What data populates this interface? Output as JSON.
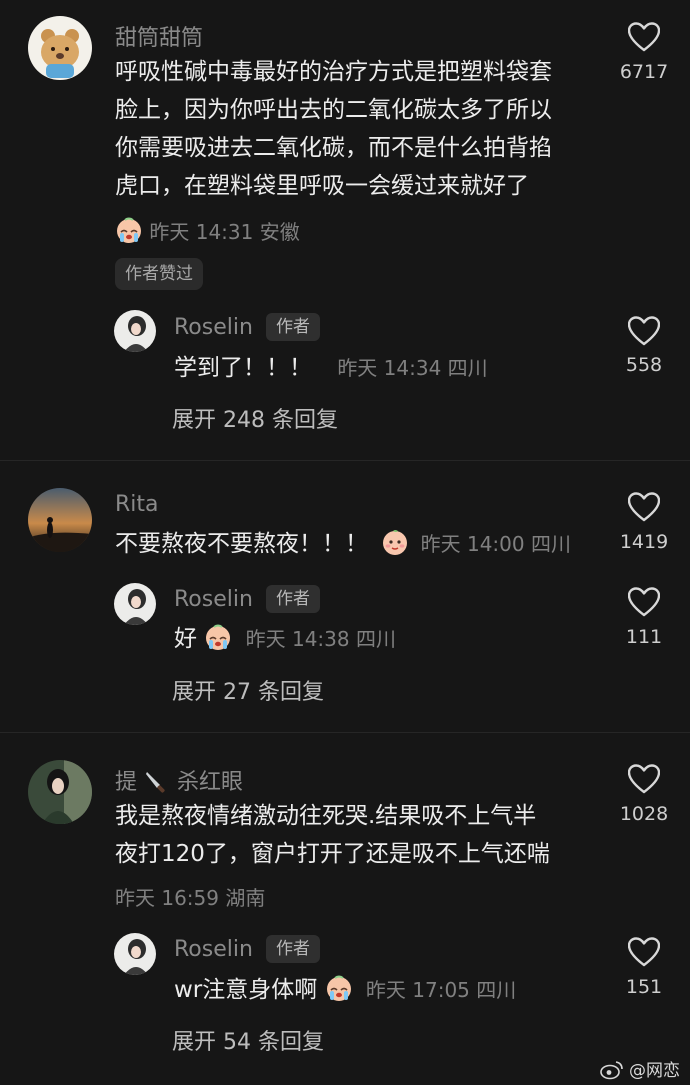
{
  "comments": [
    {
      "username": "甜筒甜筒",
      "lines": [
        "呼吸性碱中毒最好的治疗方式是把塑料袋套",
        "脸上，因为你呼出去的二氧化碳太多了所以",
        "你需要吸进去二氧化碳，而不是什么拍背掐",
        "虎口，在塑料袋里呼吸一会缓过来就好了"
      ],
      "meta": "昨天 14:31 安徽",
      "liked_tag": "作者赞过",
      "likes": "6717",
      "reply": {
        "username": "Roselin",
        "author_tag": "作者",
        "text": "学到了！！！",
        "meta": "昨天 14:34 四川",
        "likes": "558"
      },
      "expand": "展开 248 条回复"
    },
    {
      "username": "Rita",
      "lines": [
        "不要熬夜不要熬夜！！！"
      ],
      "meta": "昨天 14:00 四川",
      "likes": "1419",
      "reply": {
        "username": "Roselin",
        "author_tag": "作者",
        "text": "好",
        "meta": "昨天 14:38 四川",
        "likes": "111"
      },
      "expand": "展开 27 条回复"
    },
    {
      "username_a": "提",
      "username_b": "杀红眼",
      "lines": [
        "我是熬夜情绪激动往死哭.结果吸不上气半",
        "夜打120了，窗户打开了还是吸不上气还喘"
      ],
      "meta": "昨天 16:59 湖南",
      "likes": "1028",
      "reply": {
        "username": "Roselin",
        "author_tag": "作者",
        "text": "wr注意身体啊",
        "meta": "昨天 17:05 四川",
        "likes": "151"
      },
      "expand": "展开 54 条回复"
    }
  ],
  "watermark": "@网恋",
  "icons": {
    "like": "heart-outline-icon",
    "knife": "knife-icon",
    "weibo": "weibo-logo-icon"
  }
}
